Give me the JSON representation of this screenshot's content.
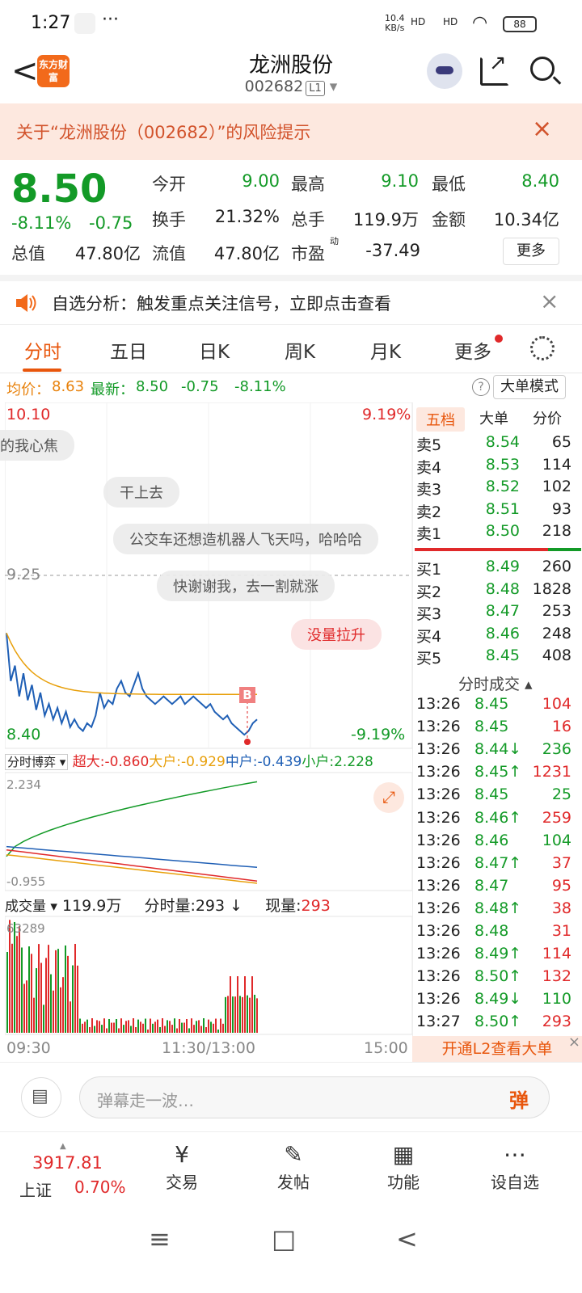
{
  "status_bar": {
    "time": "1:27",
    "dots": "···",
    "net_speed": "10.4",
    "net_unit": "KB/s",
    "signal1": "HD",
    "signal2": "HD",
    "battery": "88"
  },
  "header": {
    "back": "<",
    "logo": "东方财富",
    "title": "龙洲股份",
    "code": "002682",
    "level": "L1",
    "dropdown": "▾"
  },
  "risk_banner": {
    "text": "关于“龙洲股份（002682）”的风险提示",
    "close": "×"
  },
  "quote": {
    "price": "8.50",
    "change_pct": "-8.11%",
    "change": "-0.75",
    "fields": [
      {
        "label": "今开",
        "value": "9.00",
        "color": "green"
      },
      {
        "label": "最高",
        "value": "9.10",
        "color": "green"
      },
      {
        "label": "最低",
        "value": "8.40",
        "color": "green"
      },
      {
        "label": "换手",
        "value": "21.32%",
        "color": "black"
      },
      {
        "label": "总手",
        "value": "119.9万",
        "color": "black"
      },
      {
        "label": "金额",
        "value": "10.34亿",
        "color": "black"
      },
      {
        "label": "总值",
        "value": "47.80亿",
        "color": "black"
      },
      {
        "label": "流值",
        "value": "47.80亿",
        "color": "black"
      },
      {
        "label": "市盈",
        "value": "-37.49",
        "color": "black"
      }
    ],
    "pe_sup": "动",
    "more": "更多"
  },
  "notice": {
    "text": "自选分析：触发重点关注信号，立即点击查看",
    "close": "×"
  },
  "tabs": [
    "分时",
    "五日",
    "日K",
    "周K",
    "月K",
    "更多"
  ],
  "subbar": {
    "avg_label": "均价：",
    "avg": "8.63",
    "latest_label": "最新：",
    "latest": "8.50",
    "chg": "-0.75",
    "pct": "-8.11%",
    "help": "?",
    "mode": "大单模式"
  },
  "chart": {
    "y_high": "10.10",
    "y_mid": "9.25",
    "y_low": "8.40",
    "pct_high": "9.19%",
    "pct_low": "-9.19%",
    "marker": "B",
    "danmaku": [
      "的我心焦",
      "干上去",
      "公交车还想造机器人飞天吗，哈哈哈",
      "快谢谢我，去一割就涨",
      "没量拉升"
    ],
    "flow_label": "分时博弈 ▾",
    "flow": [
      {
        "name": "超大:",
        "value": "-0.860",
        "color": "#e0292a"
      },
      {
        "name": "大户:",
        "value": "-0.929",
        "color": "#e8a00c"
      },
      {
        "name": "中户:",
        "value": "-0.439",
        "color": "#1f5fb5"
      },
      {
        "name": "小户:",
        "value": "2.228",
        "color": "#139a27"
      }
    ],
    "flow_max": "2.234",
    "flow_min": "-0.955",
    "vol_label": "成交量 ▾",
    "vol_total": "119.9万",
    "vol_tick_label": "分时量:",
    "vol_tick": "293",
    "vol_tick_arrow": "↓",
    "vol_now_label": "现量:",
    "vol_now": "293",
    "vol_max": "63289",
    "x_labels": [
      "09:30",
      "11:30/13:00",
      "15:00"
    ]
  },
  "book": {
    "tabs": [
      "五档",
      "大单",
      "分价"
    ],
    "asks": [
      {
        "label": "卖5",
        "price": "8.54",
        "vol": "65"
      },
      {
        "label": "卖4",
        "price": "8.53",
        "vol": "114"
      },
      {
        "label": "卖3",
        "price": "8.52",
        "vol": "102"
      },
      {
        "label": "卖2",
        "price": "8.51",
        "vol": "93"
      },
      {
        "label": "卖1",
        "price": "8.50",
        "vol": "218"
      }
    ],
    "bids": [
      {
        "label": "买1",
        "price": "8.49",
        "vol": "260"
      },
      {
        "label": "买2",
        "price": "8.48",
        "vol": "1828"
      },
      {
        "label": "买3",
        "price": "8.47",
        "vol": "253"
      },
      {
        "label": "买4",
        "price": "8.46",
        "vol": "248"
      },
      {
        "label": "买5",
        "price": "8.45",
        "vol": "408"
      }
    ],
    "ticks_title": "分时成交 ▴",
    "ticks": [
      {
        "t": "13:26",
        "p": "8.45",
        "v": "104",
        "dir": "",
        "c": "red"
      },
      {
        "t": "13:26",
        "p": "8.45",
        "v": "16",
        "dir": "",
        "c": "red"
      },
      {
        "t": "13:26",
        "p": "8.44↓",
        "v": "236",
        "dir": "down",
        "c": "green"
      },
      {
        "t": "13:26",
        "p": "8.45↑",
        "v": "1231",
        "dir": "up",
        "c": "red"
      },
      {
        "t": "13:26",
        "p": "8.45",
        "v": "25",
        "dir": "",
        "c": "green"
      },
      {
        "t": "13:26",
        "p": "8.46↑",
        "v": "259",
        "dir": "up",
        "c": "red"
      },
      {
        "t": "13:26",
        "p": "8.46",
        "v": "104",
        "dir": "",
        "c": "green"
      },
      {
        "t": "13:26",
        "p": "8.47↑",
        "v": "37",
        "dir": "up",
        "c": "red"
      },
      {
        "t": "13:26",
        "p": "8.47",
        "v": "95",
        "dir": "",
        "c": "red"
      },
      {
        "t": "13:26",
        "p": "8.48↑",
        "v": "38",
        "dir": "up",
        "c": "red"
      },
      {
        "t": "13:26",
        "p": "8.48",
        "v": "31",
        "dir": "",
        "c": "red"
      },
      {
        "t": "13:26",
        "p": "8.49↑",
        "v": "114",
        "dir": "up",
        "c": "red"
      },
      {
        "t": "13:26",
        "p": "8.50↑",
        "v": "132",
        "dir": "up",
        "c": "red"
      },
      {
        "t": "13:26",
        "p": "8.49↓",
        "v": "110",
        "dir": "down",
        "c": "green"
      },
      {
        "t": "13:27",
        "p": "8.50↑",
        "v": "293",
        "dir": "up",
        "c": "red"
      }
    ],
    "l2": "开通L2查看大单"
  },
  "comment": {
    "placeholder": "弹幕走一波…",
    "dan": "弹"
  },
  "bottom_nav": {
    "index": "3917.81",
    "exchange": "上证",
    "pct": "0.70%",
    "items": [
      {
        "label": "交易",
        "icon": "yen-icon",
        "glyph": "¥"
      },
      {
        "label": "发帖",
        "icon": "edit-icon",
        "glyph": "✎"
      },
      {
        "label": "功能",
        "icon": "grid-icon",
        "glyph": "▦"
      },
      {
        "label": "设自选",
        "icon": "more-icon",
        "glyph": "⋯"
      }
    ]
  },
  "android_nav": {
    "menu": "≡",
    "home": "□",
    "back": "<"
  },
  "colors": {
    "up": "#e0292a",
    "down": "#139a27",
    "accent": "#e8560c",
    "avg_line": "#e8a00c",
    "price_line": "#1f5fb5"
  }
}
